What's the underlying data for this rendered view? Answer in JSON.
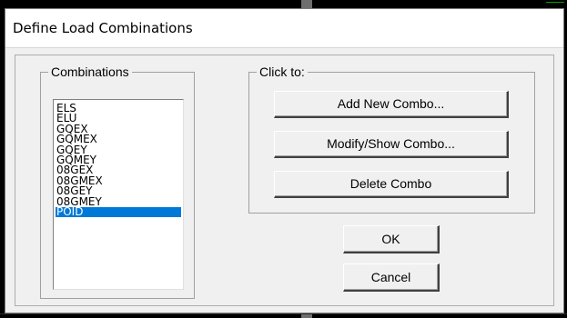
{
  "dialog": {
    "title": "Define Load Combinations",
    "combinations_group": {
      "label": "Combinations",
      "items": [
        "ELS",
        "ELU",
        "GQEX",
        "GQMEX",
        "GQEY",
        "GQMEY",
        "08GEX",
        "08GMEX",
        "08GEY",
        "08GMEY",
        "POID"
      ],
      "selected": "POID"
    },
    "click_to_group": {
      "label": "Click to:",
      "add_button": "Add New Combo...",
      "modify_button": "Modify/Show Combo...",
      "delete_button": "Delete Combo"
    },
    "ok_button": "OK",
    "cancel_button": "Cancel"
  },
  "colors": {
    "selection": "#0078d7",
    "background_accent": "#00a000"
  }
}
